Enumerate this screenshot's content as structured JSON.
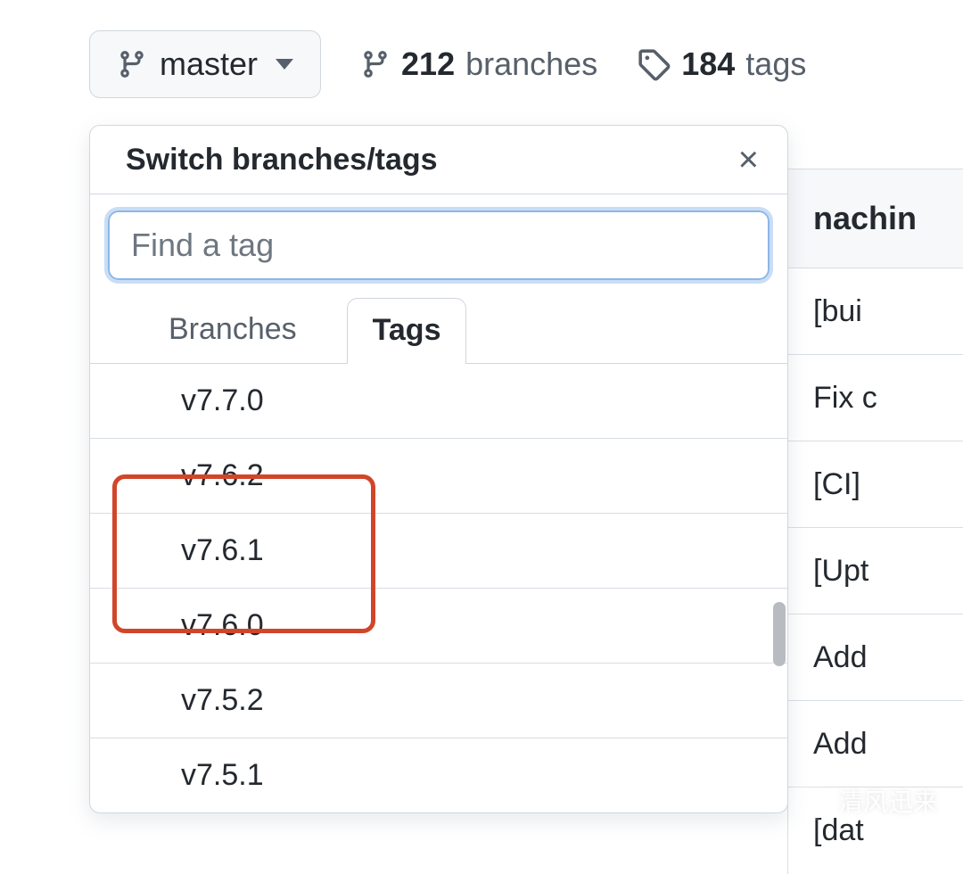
{
  "branchSelector": {
    "currentBranch": "master"
  },
  "stats": {
    "branchCount": "212",
    "branchLabel": "branches",
    "tagCount": "184",
    "tagLabel": "tags"
  },
  "bgList": {
    "header": "nachin",
    "rows": [
      "[bui",
      "Fix c",
      "[CI]",
      "[Upt",
      "Add",
      "Add",
      "[dat"
    ]
  },
  "popover": {
    "title": "Switch branches/tags",
    "searchPlaceholder": "Find a tag",
    "tabs": {
      "branches": "Branches",
      "tags": "Tags"
    },
    "tagList": [
      "v7.7.0",
      "v7.6.2",
      "v7.6.1",
      "v7.6.0",
      "v7.5.2",
      "v7.5.1"
    ],
    "highlightedTags": [
      "v7.6.2",
      "v7.6.1"
    ]
  },
  "watermark": {
    "text": "清风迅来"
  }
}
